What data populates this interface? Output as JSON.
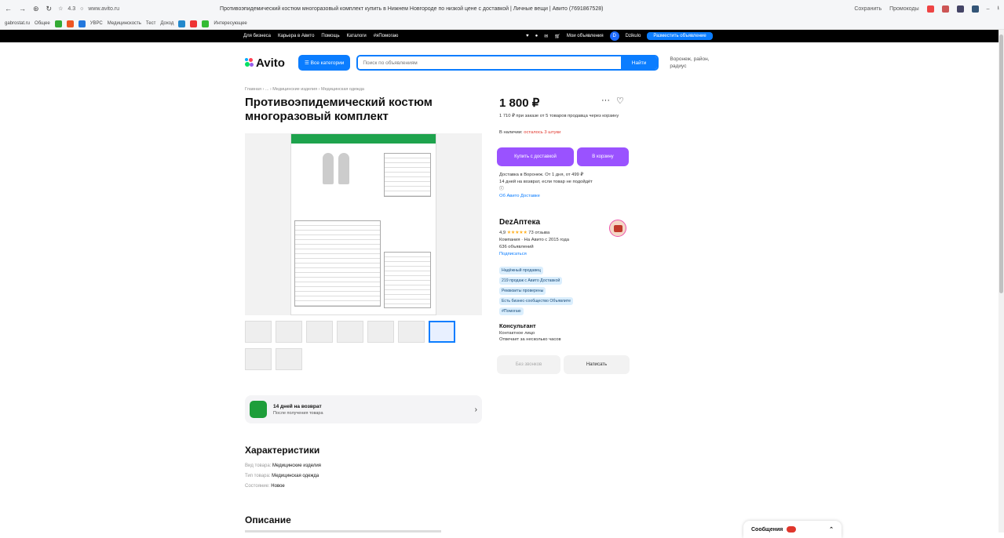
{
  "browser": {
    "address": "www.avito.ru",
    "rating": "4.3",
    "page_title": "Противоэпидемический костюм многоразовый комплект купить в Нижнем Новгороде по низкой цене с доставкой | Личные вещи | Авито (7691867528)",
    "save_label": "Сохранить",
    "promo_label": "Промокоды",
    "bookmarks": [
      "gabrostat.ru",
      "Общее",
      "УВРС",
      "Медицинскость",
      "Тест",
      "Доход",
      "Интересующее"
    ]
  },
  "topbar": {
    "links": [
      "Для бизнеса",
      "Карьера в Авито",
      "Помощь",
      "Каталоги",
      "#яПомогаю"
    ],
    "my_ads": "Мои объявления",
    "profile": "Dzikulo",
    "post_ad": "Разместить объявление"
  },
  "header": {
    "logo": "Avito",
    "categories": "Все категории",
    "search_placeholder": "Поиск по объявлениям",
    "find": "Найти",
    "location_line1": "Воронеж, район,",
    "location_line2": "радиус"
  },
  "breadcrumbs": "Главная › ... › Медицинские изделия › Медицинская одежда",
  "product": {
    "title": "Противоэпидемический костюм многоразовый комплект",
    "price": "1 800 ₽",
    "bulk": "1 710 ₽ при заказе от 5 товаров продавца через корзину",
    "availability_label": "В наличии:",
    "availability_value": "осталось 3 штуки",
    "buy_with_delivery": "Купить с доставкой",
    "to_cart": "В корзину",
    "delivery1": "Доставка в Воронеж. От 1 дня, от 499 ₽",
    "delivery2": "14 дней на возврат, если товар не подойдёт",
    "delivery_link": "Об Авито Доставке"
  },
  "seller": {
    "name": "DezАптека",
    "rating": "4,9",
    "stars": "★★★★★",
    "reviews": "73 отзыва",
    "since": "Компания · На Авито с 2015 года",
    "ads": "636 объявлений",
    "subscribe": "Подписаться",
    "badges": [
      "Надёжный продавец",
      "219 продаж с Авито Доставкой",
      "Реквизиты проверены",
      "Есть бизнес-сообщество Объявлите",
      "#Помогаю"
    ]
  },
  "consultant": {
    "title": "Консультант",
    "role": "Контактное лицо",
    "reply": "Отвечает за несколько часов"
  },
  "actions": {
    "call": "Без звонков",
    "write": "Написать"
  },
  "promo": {
    "title": "14 дней на возврат",
    "subtitle": "После получения товара"
  },
  "characteristics": {
    "title": "Характеристики",
    "items": [
      {
        "k": "Вид товара:",
        "v": "Медицинские изделия"
      },
      {
        "k": "Тип товара:",
        "v": "Медицинская одежда"
      },
      {
        "k": "Состояние:",
        "v": "Новое"
      }
    ]
  },
  "description_title": "Описание",
  "messages": {
    "label": "Сообщения"
  }
}
